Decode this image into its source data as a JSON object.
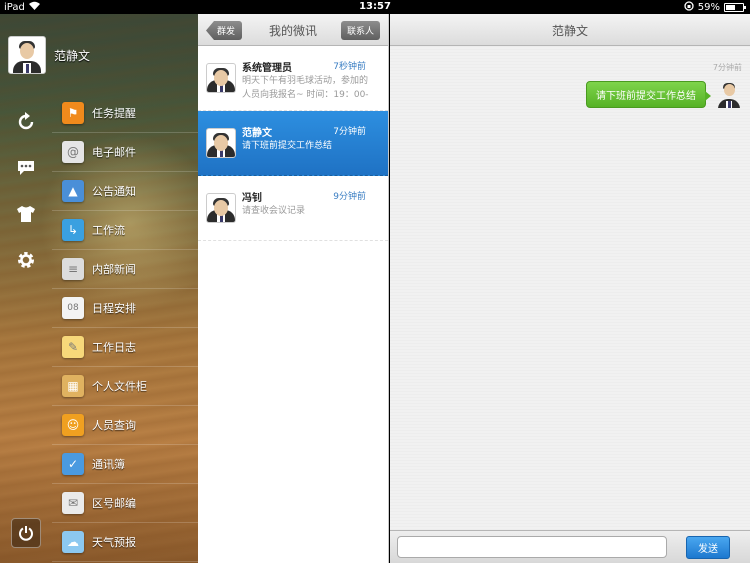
{
  "status": {
    "device": "iPad",
    "time": "13:57",
    "battery": "59%",
    "battery_level": 0.59
  },
  "user": {
    "name": "范静文"
  },
  "side_icons": [
    "refresh-icon",
    "chat-bubble-icon",
    "tshirt-icon",
    "gear-icon"
  ],
  "menu": [
    {
      "label": "任务提醒",
      "icon": "task-reminder-icon",
      "color": "#f08a1c"
    },
    {
      "label": "电子邮件",
      "icon": "email-icon",
      "color": "#e5e5e5"
    },
    {
      "label": "公告通知",
      "icon": "announcement-icon",
      "color": "#4a8fd8"
    },
    {
      "label": "工作流",
      "icon": "workflow-icon",
      "color": "#3aa0e0"
    },
    {
      "label": "内部新闻",
      "icon": "news-icon",
      "color": "#dcdcdc"
    },
    {
      "label": "日程安排",
      "icon": "calendar-icon",
      "color": "#f3f3f3"
    },
    {
      "label": "工作日志",
      "icon": "notepad-icon",
      "color": "#f7d87a"
    },
    {
      "label": "个人文件柜",
      "icon": "file-cabinet-icon",
      "color": "#e0b260"
    },
    {
      "label": "人员查询",
      "icon": "people-search-icon",
      "color": "#f0a020"
    },
    {
      "label": "通讯簿",
      "icon": "address-book-icon",
      "color": "#4a9ae0"
    },
    {
      "label": "区号邮编",
      "icon": "postcode-icon",
      "color": "#eaeaea"
    },
    {
      "label": "天气预报",
      "icon": "weather-icon",
      "color": "#8cc8f0"
    }
  ],
  "middle": {
    "title": "我的微讯",
    "back_label": "群发",
    "contacts_label": "联系人",
    "messages": [
      {
        "sender": "系统管理员",
        "time": "7秒钟前",
        "preview": "明天下午有羽毛球活动，参加的人员向我报名~ 时间：19：00-",
        "selected": false
      },
      {
        "sender": "范静文",
        "time": "7分钟前",
        "preview": "请下班前提交工作总结",
        "selected": true
      },
      {
        "sender": "冯钊",
        "time": "9分钟前",
        "preview": "请查收会议记录",
        "selected": false
      }
    ]
  },
  "chat": {
    "title": "范静文",
    "timestamp": "7分钟前",
    "message": "请下班前提交工作总结",
    "input_value": "",
    "send_label": "发送"
  }
}
